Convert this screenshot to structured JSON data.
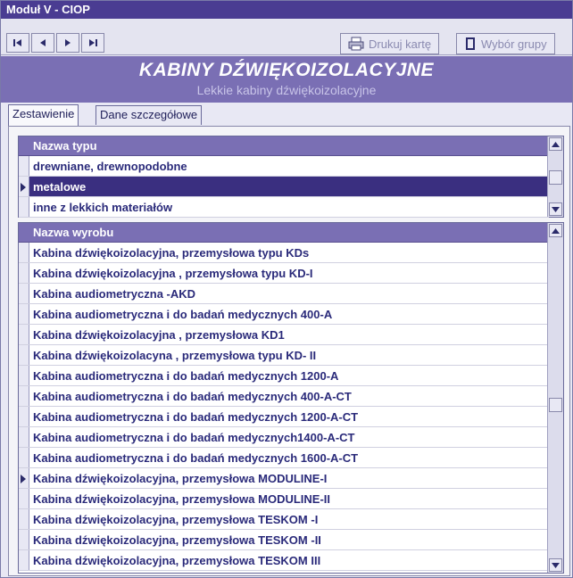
{
  "window": {
    "title": "Moduł V - CIOP"
  },
  "toolbar": {
    "nav": [
      {
        "name": "first-record-button",
        "icon": "first-record-icon"
      },
      {
        "name": "previous-record-button",
        "icon": "previous-record-icon"
      },
      {
        "name": "next-record-button",
        "icon": "next-record-icon"
      },
      {
        "name": "last-record-button",
        "icon": "last-record-icon"
      }
    ],
    "print_label": "Drukuj kartę",
    "print_icon": "printer-icon",
    "group_label": "Wybór grupy",
    "group_icon": "book-icon"
  },
  "banner": {
    "title": "KABINY DŹWIĘKOIZOLACYJNE",
    "subtitle": "Lekkie kabiny dźwiękoizolacyjne"
  },
  "tabs": [
    {
      "label": "Zestawienie",
      "active": true
    },
    {
      "label": "Dane szczegółowe",
      "active": false
    }
  ],
  "types_grid": {
    "header": "Nazwa typu",
    "rows": [
      "drewniane, drewnopodobne",
      "metalowe",
      "inne z lekkich materiałów"
    ],
    "selected_index": 1
  },
  "products_grid": {
    "header": "Nazwa wyrobu",
    "rows": [
      "Kabina dźwiękoizolacyjna, przemysłowa typu KDs",
      "Kabina dźwiękoizolacyjna , przemysłowa typu KD-I",
      "Kabina audiometryczna -AKD",
      "Kabina audiometryczna i do badań medycznych 400-A",
      "Kabina dźwiękoizolacyjna , przemysłowa KD1",
      "Kabina dźwiękoizolacyna , przemysłowa typu KD- II",
      "Kabina audiometryczna i do badań medycznych 1200-A",
      "Kabina audiometryczna i do badań medycznych 400-A-CT",
      "Kabina audiometryczna i do badań medycznych 1200-A-CT",
      "Kabina audiometryczna i do badań medycznych1400-A-CT",
      "Kabina audiometryczna i do badań medycznych 1600-A-CT",
      "Kabina dźwiękoizolacyjna, przemysłowa MODULINE-I",
      "Kabina dźwiękoizolacyjna, przemysłowa MODULINE-II",
      "Kabina dźwiękoizolacyjna, przemysłowa TESKOM -I",
      "Kabina dźwiękoizolacyjna, przemysłowa TESKOM -II",
      "Kabina dźwiękoizolacyjna, przemysłowa TESKOM III"
    ],
    "current_index": 11
  },
  "colors": {
    "titlebar": "#4a3c92",
    "banner": "#7a6fb4",
    "header": "#7a6fb4",
    "selected_row": "#3a2f80",
    "row_text": "#2a2a7a"
  }
}
